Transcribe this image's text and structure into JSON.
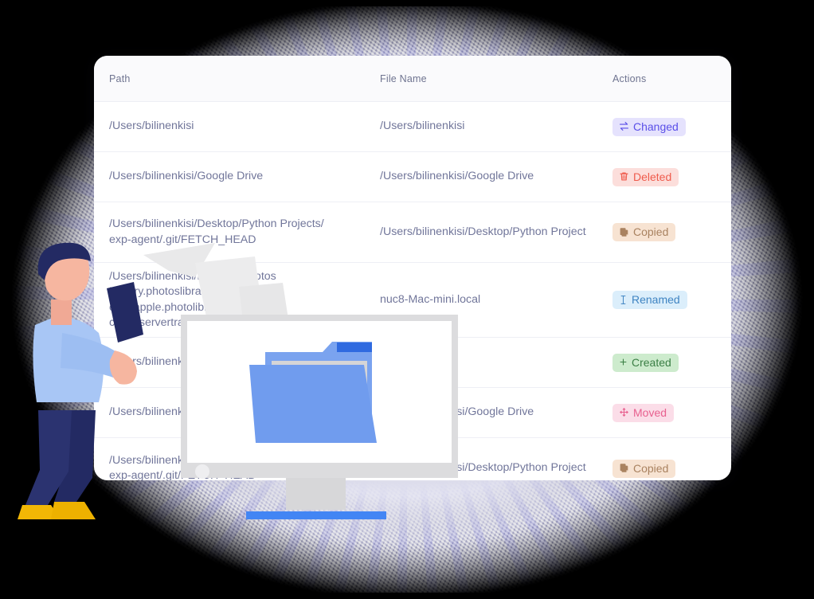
{
  "table": {
    "columns": [
      {
        "key": "path",
        "label": "Path"
      },
      {
        "key": "file",
        "label": "File Name"
      },
      {
        "key": "action",
        "label": "Actions"
      }
    ],
    "rows": [
      {
        "path": "/Users/bilinenkisi",
        "file": "/Users/bilinenkisi",
        "action": {
          "label": "Changed",
          "icon": "swap-arrows-icon",
          "style": "changed"
        }
      },
      {
        "path": "/Users/bilinenkisi/Google Drive",
        "file": "/Users/bilinenkisi/Google Drive",
        "action": {
          "label": "Deleted",
          "icon": "trash-icon",
          "style": "deleted"
        }
      },
      {
        "path": "/Users/bilinenkisi/Desktop/Python Projects/\nexp-agent/.git/FETCH_HEAD",
        "file": "/Users/bilinenkisi/Desktop/Python Project",
        "action": {
          "label": "Copied",
          "icon": "copy-icon",
          "style": "copied"
        }
      },
      {
        "path": "/Users/bilinenkisi/Pictures/Photos\nLibrary.photoslibrary/private/\ncom.apple.photolibraryd/cac\nclient-servertransaction",
        "file": "nuc8-Mac-mini.local",
        "action": {
          "label": "Renamed",
          "icon": "text-cursor-icon",
          "style": "renamed"
        }
      },
      {
        "path": "/Users/bilinenkisi",
        "file": "",
        "action": {
          "label": "Created",
          "icon": "plus-icon",
          "style": "created"
        }
      },
      {
        "path": "/Users/bilinenkisi",
        "file": "/Users/bilinenkisi/Google Drive",
        "action": {
          "label": "Moved",
          "icon": "move-arrows-icon",
          "style": "moved"
        }
      },
      {
        "path": "/Users/bilinenkisi/Desktop/Python Projects/\nexp-agent/.git/FETCH_HEAD",
        "file": "/Users/bilinenkisi/Desktop/Python Project",
        "action": {
          "label": "Copied",
          "icon": "copy-icon",
          "style": "copied"
        }
      }
    ]
  },
  "colors": {
    "backdrop": "#e3e3f0",
    "card": "#ffffff",
    "header_bg": "#fafafc",
    "text": "#71769a",
    "changed": "#5a4fe8",
    "deleted": "#ef5b4c",
    "copied": "#a98260",
    "renamed": "#3f84c2",
    "created": "#3b7f45",
    "moved": "#e8608f",
    "folder_blue": "#6e9ef0",
    "monitor_accent": "#4285f4",
    "shirt_blue": "#a8c6f5",
    "hair_navy": "#252a63",
    "shoes_yellow": "#f2b705",
    "skin": "#f6b6a0"
  },
  "illustration": {
    "person": "person-holding-phone",
    "monitor": "desktop-monitor-with-folder",
    "papers": "floating-paper-sheets"
  }
}
